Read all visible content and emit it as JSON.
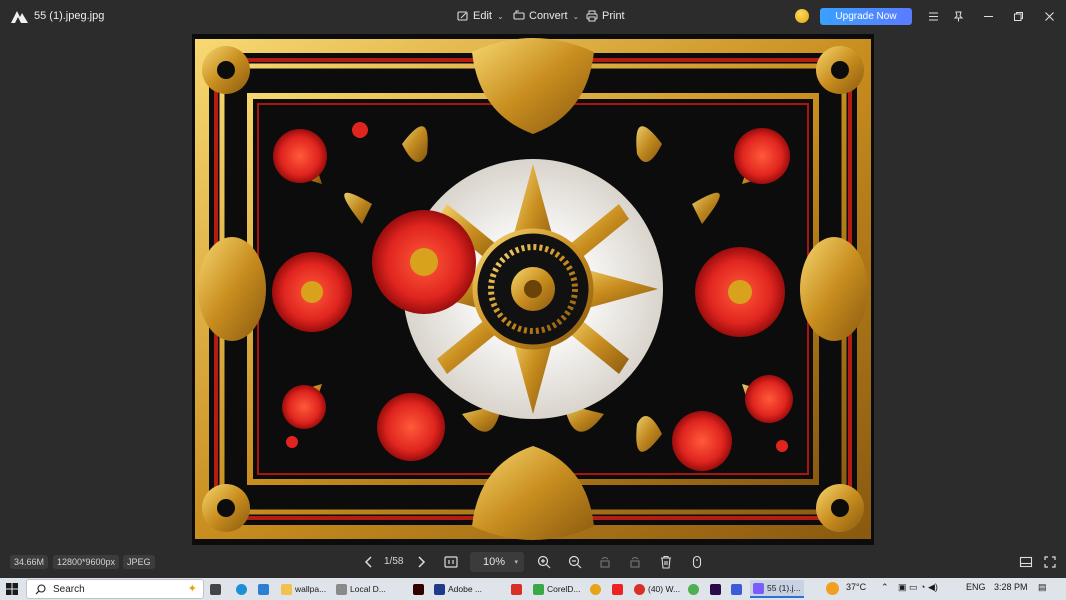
{
  "titlebar": {
    "filename": "55 (1).jpeg.jpg",
    "menu": {
      "edit": "Edit",
      "convert": "Convert",
      "print": "Print"
    },
    "upgrade_label": "Upgrade Now"
  },
  "image": {
    "description_icon": "ornate-floral-frame-image"
  },
  "bottombar": {
    "file_size": "34.66M",
    "dimensions": "12800*9600px",
    "format": "JPEG",
    "page_indicator": "1/58",
    "zoom": "10%"
  },
  "taskbar": {
    "search_label": "Search",
    "apps": [
      {
        "label": "wallpa...",
        "color": "#f2c14e"
      },
      {
        "label": "Local D...",
        "color": "#f2c14e"
      },
      {
        "label": "Adobe ...",
        "color": "#1f3a8a"
      },
      {
        "label": "CorelD...",
        "color": "#39a845"
      },
      {
        "label": "(40) W...",
        "color": "#d93025"
      },
      {
        "label": "55 (1).j...",
        "color": "#7a5cff"
      }
    ],
    "weather": "37°C",
    "language": "ENG",
    "time": "3:28 PM"
  },
  "colors": {
    "accent": "#3aa0ff",
    "frame_gold": "#d9a62e",
    "flower_red": "#e0251f"
  }
}
